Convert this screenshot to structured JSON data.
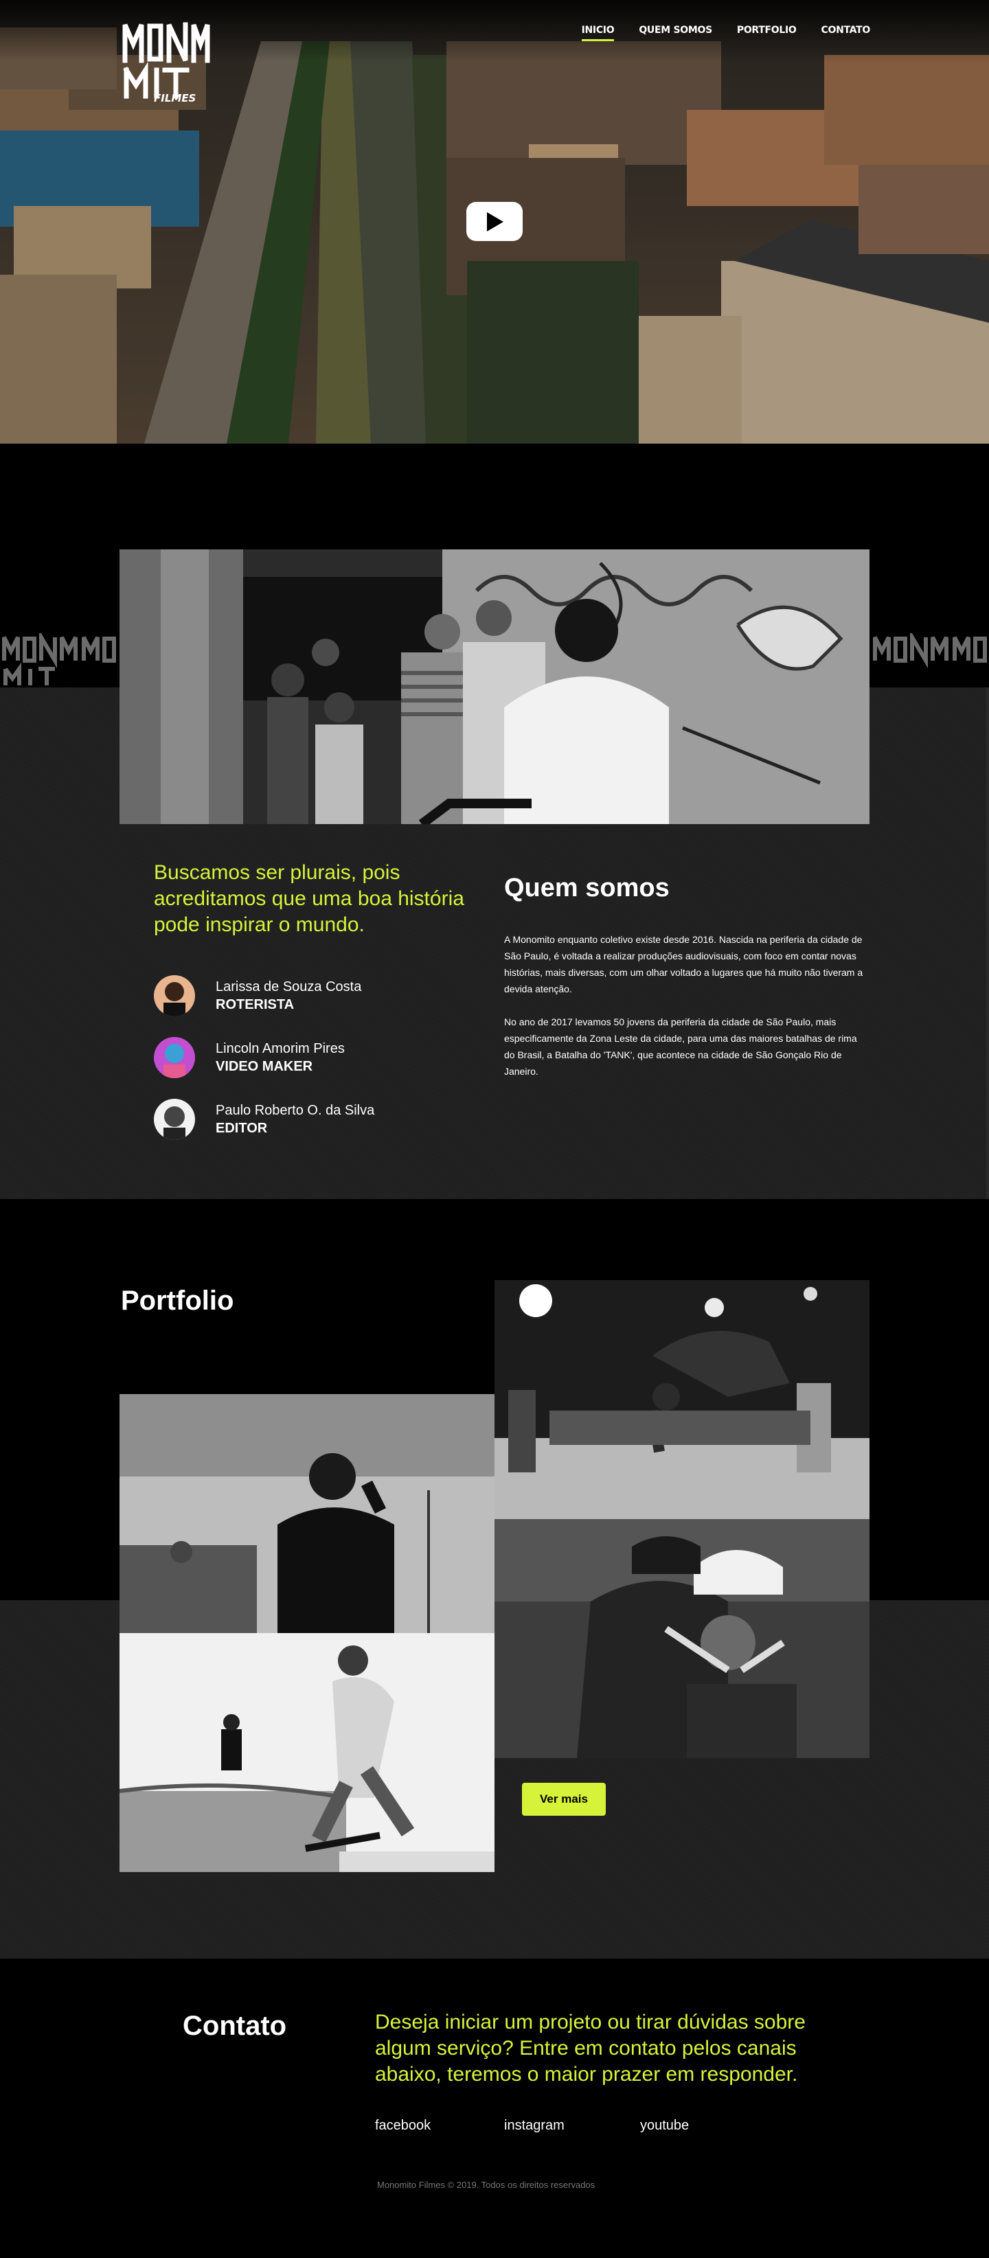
{
  "brand": {
    "logo_text_top": "MONM",
    "logo_text_bottom": "ITO",
    "logo_subtitle": "FILMES"
  },
  "nav": {
    "items": [
      {
        "label": "INICIO",
        "active": true
      },
      {
        "label": "QUEM SOMOS",
        "active": false
      },
      {
        "label": "PORTFOLIO",
        "active": false
      },
      {
        "label": "CONTATO",
        "active": false
      }
    ]
  },
  "hero": {
    "play_icon": "play-icon"
  },
  "about": {
    "watermark": "MONOMITO",
    "quote": "Buscamos ser plurais, pois acreditamos que uma boa história pode inspirar o mundo.",
    "title": "Quem somos",
    "paragraphs": [
      "A Monomito enquanto coletivo existe desde 2016. Nascida na periferia da cidade de São Paulo, é voltada a realizar produções audiovisuais, com foco em contar novas histórias, mais diversas, com um olhar voltado a lugares que há muito não tiveram a devida atenção.",
      "No ano de 2017 levamos 50 jovens da periferia da cidade de São Paulo, mais especificamente da Zona Leste da cidade, para uma das maiores batalhas de rima do Brasil, a Batalha do 'TANK', que acontece na cidade de São Gonçalo Rio de Janeiro."
    ],
    "team": [
      {
        "name": "Larissa de Souza Costa",
        "role": "ROTERISTA"
      },
      {
        "name": "Lincoln Amorim Pires",
        "role": "VIDEO MAKER"
      },
      {
        "name": "Paulo Roberto O. da Silva",
        "role": "EDITOR"
      }
    ]
  },
  "portfolio": {
    "title": "Portfolio",
    "button_label": "Ver mais"
  },
  "contact": {
    "title": "Contato",
    "text": "Deseja iniciar um projeto ou tirar dúvidas sobre algum serviço? Entre em contato pelos canais abaixo, teremos o maior prazer em responder.",
    "links": {
      "facebook": "facebook",
      "instagram": "instagram",
      "youtube": "youtube"
    },
    "copyright": "Monomito Filmes © 2019. Todos os direitos reservados"
  },
  "colors": {
    "accent": "#d6f33a",
    "background": "#000000",
    "band": "#1f1f1f"
  }
}
